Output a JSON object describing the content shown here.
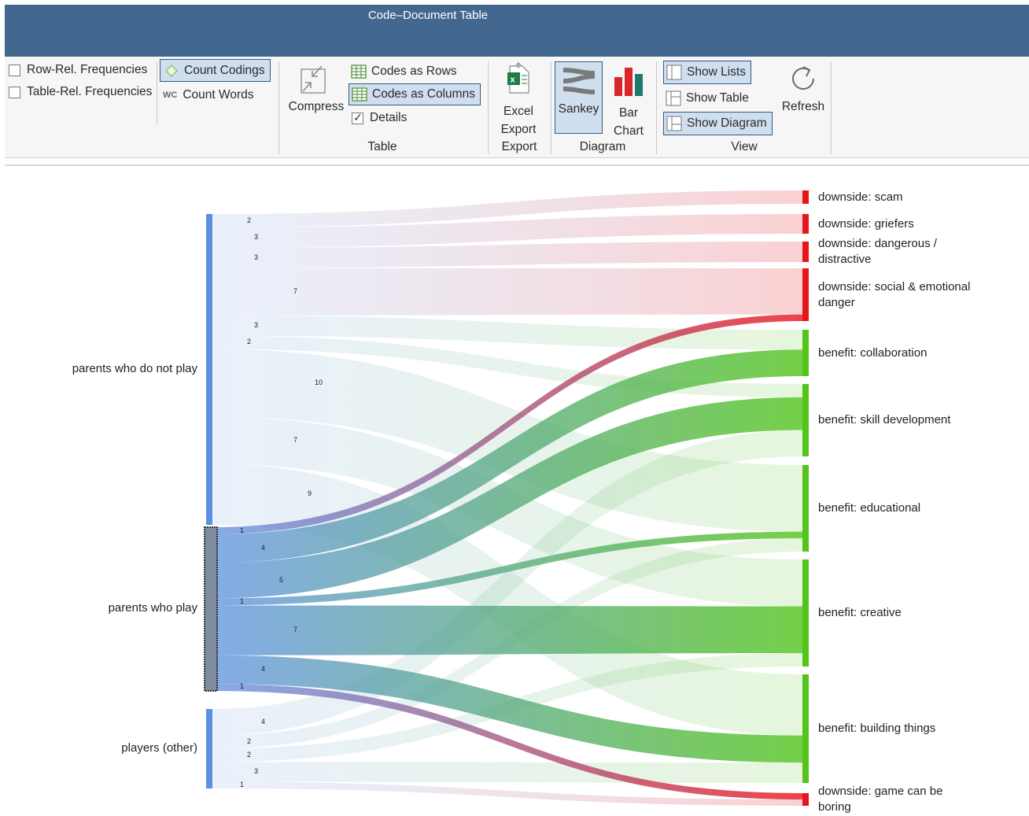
{
  "window": {
    "title": "Code–Document Table"
  },
  "ribbon": {
    "row_rel": "Row-Rel. Frequencies",
    "table_rel": "Table-Rel. Frequencies",
    "count_codings": "Count Codings",
    "wc_badge": "WC",
    "count_words": "Count Words",
    "compress": "Compress",
    "codes_as_rows": "Codes as Rows",
    "codes_as_columns": "Codes as Columns",
    "details": "Details",
    "table_group": "Table",
    "excel_1": "Excel",
    "excel_2": "Export",
    "export_group": "Export",
    "sankey": "Sankey",
    "bar_1": "Bar",
    "bar_2": "Chart",
    "diagram_group": "Diagram",
    "show_lists": "Show Lists",
    "show_table": "Show Table",
    "show_diagram": "Show Diagram",
    "view_group": "View",
    "refresh": "Refresh"
  },
  "state": {
    "row_rel_checked": false,
    "table_rel_checked": false,
    "details_checked": true,
    "selected_tools": [
      "Count Codings",
      "Codes as Columns",
      "Sankey",
      "Show Lists",
      "Show Diagram"
    ]
  },
  "colors": {
    "titlebar": "#436890",
    "source_bar": "#5b8fe0",
    "downside": "#e8151b",
    "benefit": "#52c41a"
  },
  "sankey": {
    "sources": [
      {
        "id": "np",
        "label": "parents who do not play"
      },
      {
        "id": "pp",
        "label": "parents who play"
      },
      {
        "id": "pl",
        "label": "players (other)"
      }
    ],
    "targets": [
      {
        "id": "scam",
        "line1": "downside: scam",
        "line2": "",
        "kind": "downside"
      },
      {
        "id": "grief",
        "line1": "downside: griefers",
        "line2": "",
        "kind": "downside"
      },
      {
        "id": "dang",
        "line1": "downside: dangerous /",
        "line2": "distractive",
        "kind": "downside"
      },
      {
        "id": "social",
        "line1": "downside: social & emotional",
        "line2": "danger",
        "kind": "downside"
      },
      {
        "id": "collab",
        "line1": "benefit: collaboration",
        "line2": "",
        "kind": "benefit"
      },
      {
        "id": "skill",
        "line1": "benefit: skill development",
        "line2": "",
        "kind": "benefit"
      },
      {
        "id": "edu",
        "line1": "benefit: educational",
        "line2": "",
        "kind": "benefit"
      },
      {
        "id": "creative",
        "line1": "benefit: creative",
        "line2": "",
        "kind": "benefit"
      },
      {
        "id": "build",
        "line1": "benefit: building things",
        "line2": "",
        "kind": "benefit"
      },
      {
        "id": "boring",
        "line1": "downside: game can be",
        "line2": "boring",
        "kind": "downside"
      }
    ],
    "flows": [
      {
        "s": "np",
        "t": "scam",
        "v": 2
      },
      {
        "s": "np",
        "t": "grief",
        "v": 3
      },
      {
        "s": "np",
        "t": "dang",
        "v": 3
      },
      {
        "s": "np",
        "t": "social",
        "v": 7
      },
      {
        "s": "np",
        "t": "collab",
        "v": 3
      },
      {
        "s": "np",
        "t": "skill",
        "v": 2
      },
      {
        "s": "np",
        "t": "edu",
        "v": 10
      },
      {
        "s": "np",
        "t": "creative",
        "v": 7
      },
      {
        "s": "np",
        "t": "build",
        "v": 9
      },
      {
        "s": "pp",
        "t": "social",
        "v": 1
      },
      {
        "s": "pp",
        "t": "collab",
        "v": 4
      },
      {
        "s": "pp",
        "t": "skill",
        "v": 5
      },
      {
        "s": "pp",
        "t": "edu",
        "v": 1
      },
      {
        "s": "pp",
        "t": "creative",
        "v": 7
      },
      {
        "s": "pp",
        "t": "build",
        "v": 4
      },
      {
        "s": "pp",
        "t": "boring",
        "v": 1
      },
      {
        "s": "pl",
        "t": "skill",
        "v": 4
      },
      {
        "s": "pl",
        "t": "edu",
        "v": 2
      },
      {
        "s": "pl",
        "t": "creative",
        "v": 2
      },
      {
        "s": "pl",
        "t": "build",
        "v": 3
      },
      {
        "s": "pl",
        "t": "boring",
        "v": 1
      }
    ],
    "highlighted_source": "pp"
  }
}
